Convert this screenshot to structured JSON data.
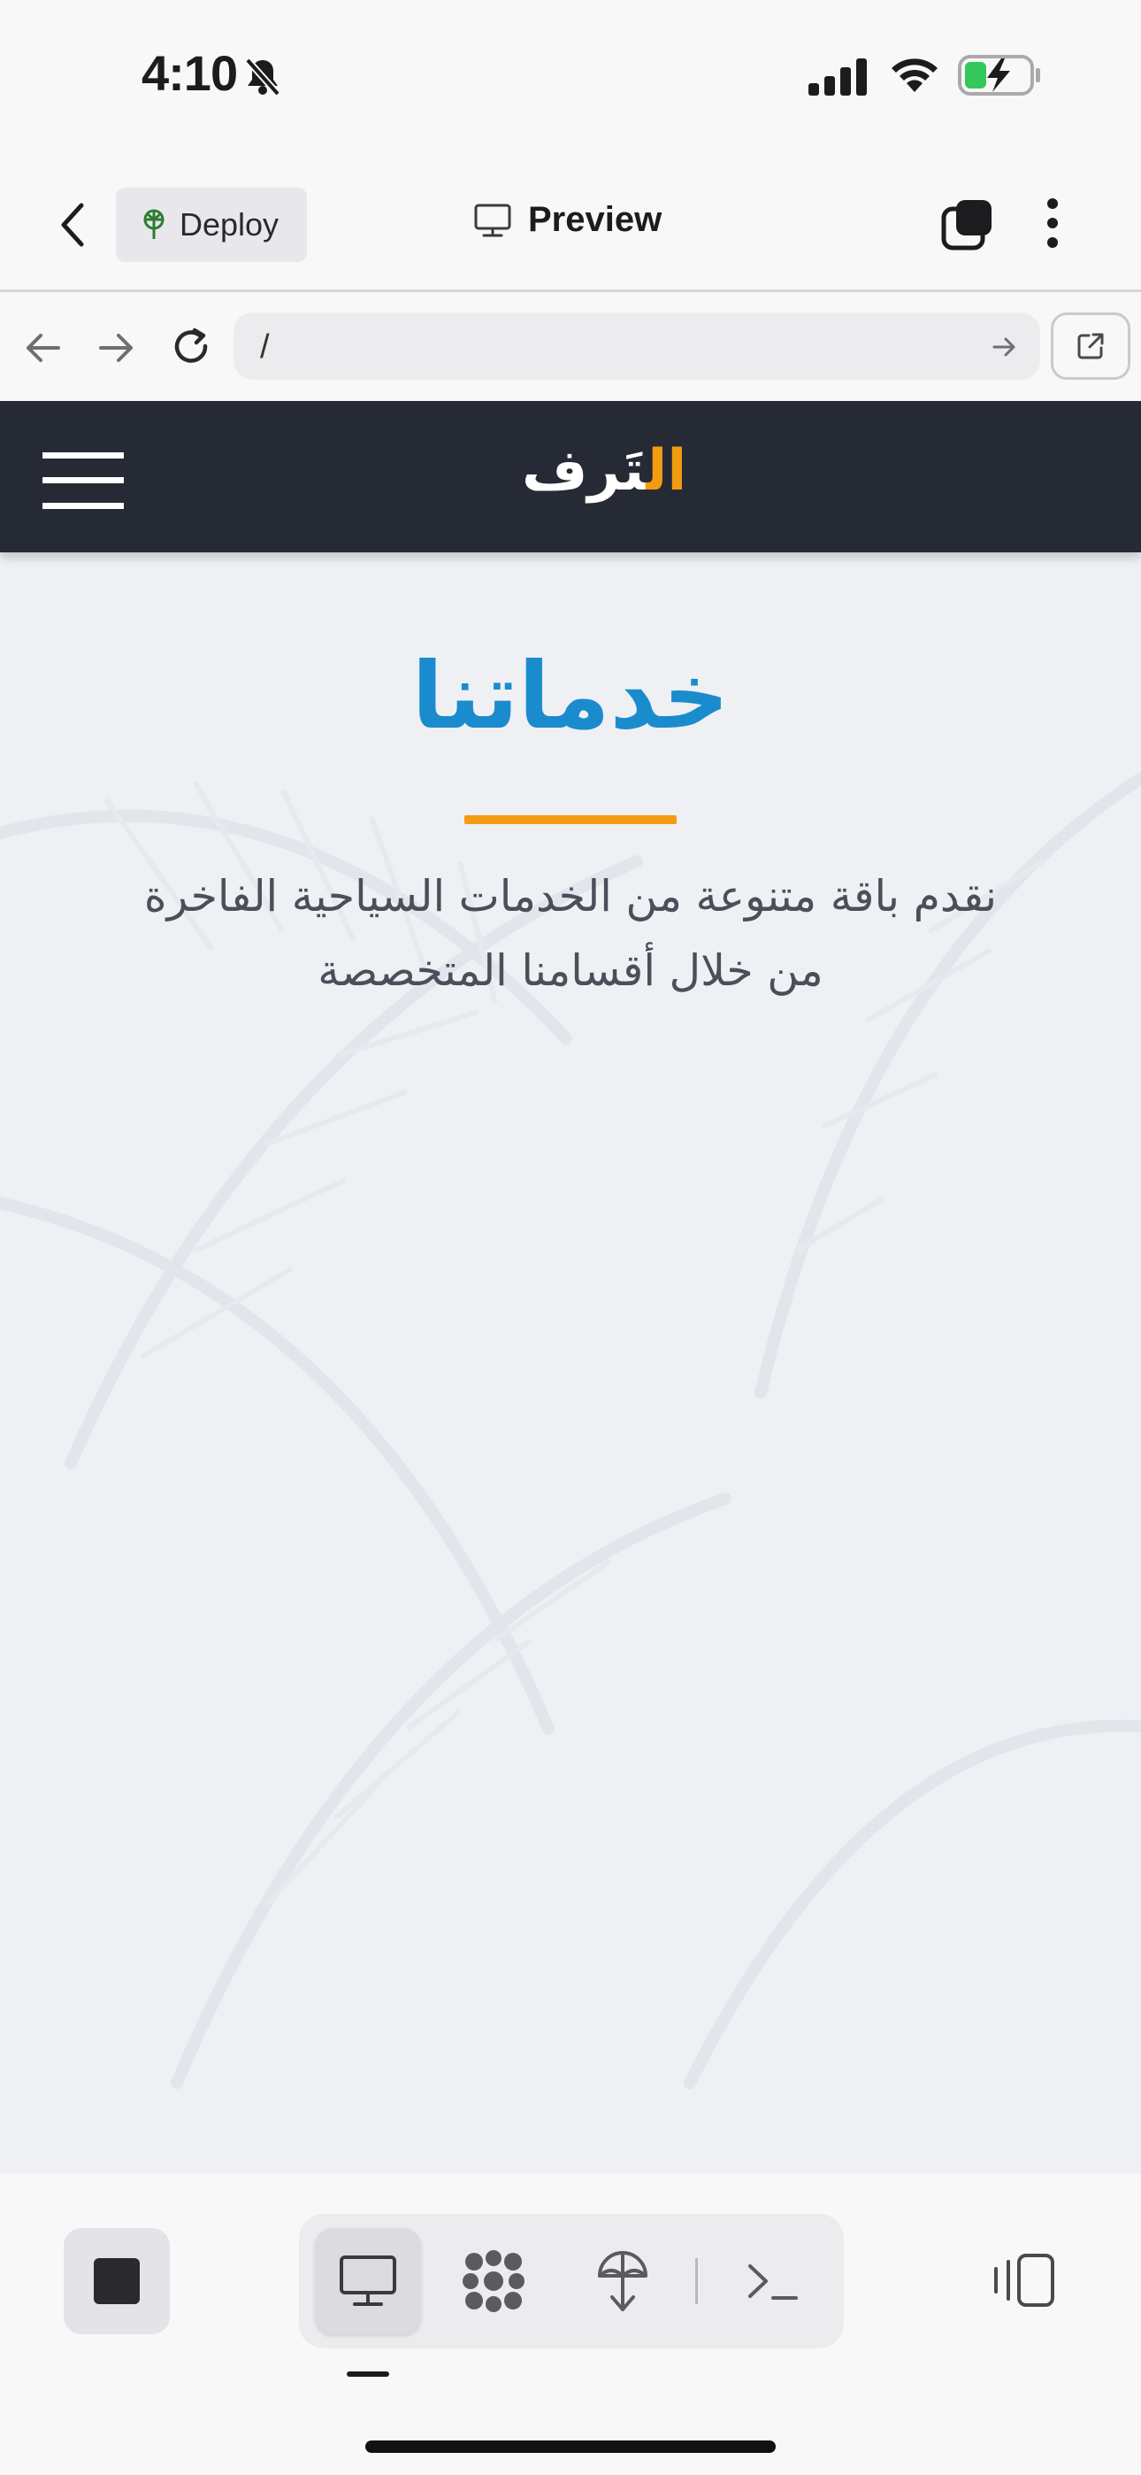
{
  "status_bar": {
    "time": "4:10"
  },
  "app_bar": {
    "deploy_label": "Deploy",
    "title": "Preview"
  },
  "url_bar": {
    "url": "/"
  },
  "site": {
    "logo": "التَرف",
    "logo_parts": [
      "ال",
      "تَرف"
    ],
    "heading": "خدماتنا",
    "subtitle_lines": [
      "نقدم باقة متنوعة من الخدمات السياحية الفاخرة",
      "من خلال أقسامنا المتخصصة"
    ],
    "colors": {
      "nav_bg": "#252a35",
      "heading": "#1a8ccd",
      "accent": "#f39c12"
    }
  },
  "bottom_toolbar": {
    "tools": [
      "desktop-preview-icon",
      "grid-icon",
      "deploy-icon",
      "terminal-icon"
    ],
    "selected": "desktop-preview-icon"
  }
}
